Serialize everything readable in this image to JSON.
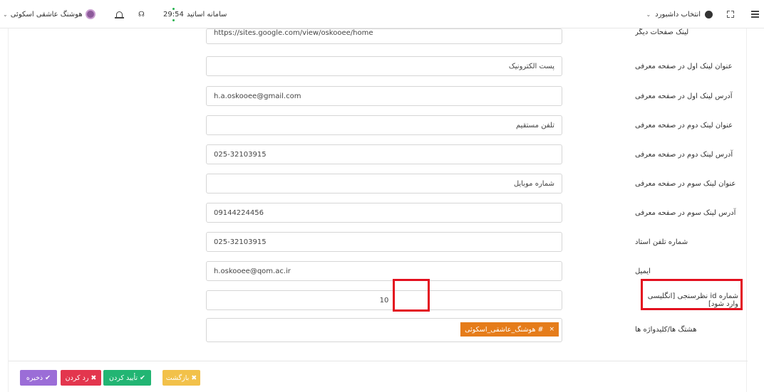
{
  "topbar": {
    "dashboard_select": "انتخاب داشبورد",
    "system_title": "سامانه اساتید",
    "timer": "29:54",
    "user_name": "هوشنگ عاشقی اسکوئی"
  },
  "form": {
    "fields": [
      {
        "label": "لینک صفحات دیگر",
        "value": "https://sites.google.com/view/oskooee/home",
        "dir": "ltr"
      },
      {
        "label": "عنوان لینک اول در صفحه معرفی",
        "value": "پست الکترونیک",
        "dir": "rtl"
      },
      {
        "label": "آدرس لینک اول در صفحه معرفی",
        "value": "h.a.oskooee@gmail.com",
        "dir": "ltr"
      },
      {
        "label": "عنوان لینک دوم در صفحه معرفی",
        "value": "تلفن مستقیم",
        "dir": "rtl"
      },
      {
        "label": "آدرس لینک دوم در صفحه معرفی",
        "value": "025-32103915",
        "dir": "ltr"
      },
      {
        "label": "عنوان لینک سوم در صفحه معرفی",
        "value": "شماره موبایل",
        "dir": "rtl"
      },
      {
        "label": "آدرس لینک سوم در صفحه معرفی",
        "value": "09144224456",
        "dir": "ltr"
      },
      {
        "label": "شماره تلفن استاد",
        "value": "025-32103915",
        "dir": "ltr"
      },
      {
        "label": "ایمیل",
        "value": "h.oskooee@qom.ac.ir",
        "dir": "ltr"
      },
      {
        "label": "شماره id نظرسنجی [انگلیسی وارد شود]",
        "value": "10",
        "dir": "center"
      }
    ],
    "hashtags_label": "هشتگ ها/کلیدواژه ها",
    "hashtag_tag": "# هوشنگ_عاشقی_اسکوئی"
  },
  "buttons": {
    "back": "بازگشت",
    "confirm": "تأیید کردن",
    "reject": "رد کردن",
    "save": "ذخیره"
  },
  "colors": {
    "highlight": "#e3101f",
    "tag": "#e57c1a",
    "back": "#f2c14a",
    "confirm": "#22b573",
    "reject": "#e3364e",
    "save": "#9b6dd7"
  }
}
